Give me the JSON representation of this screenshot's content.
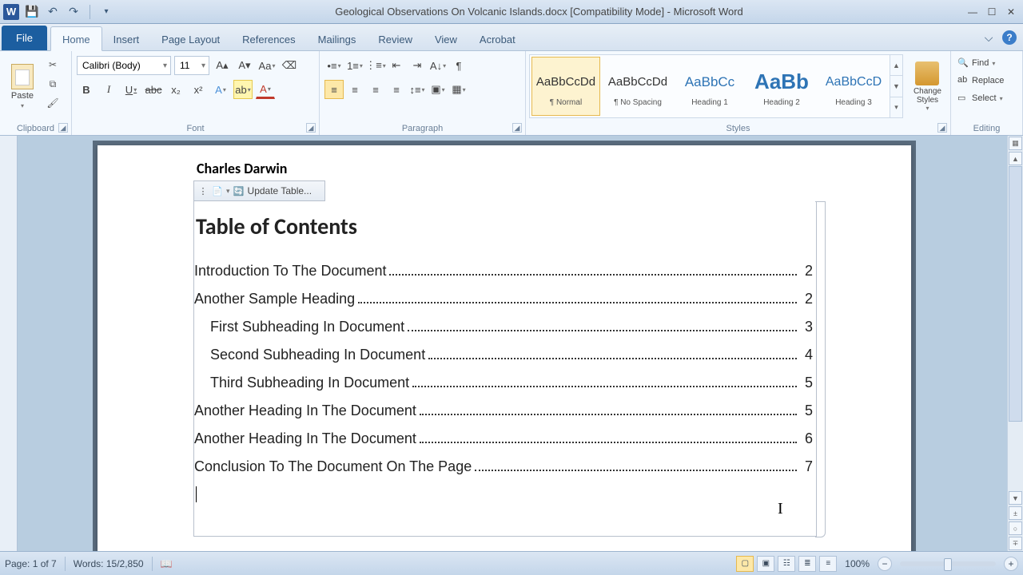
{
  "title": "Geological Observations On Volcanic Islands.docx [Compatibility Mode] - Microsoft Word",
  "tabs": {
    "file": "File",
    "home": "Home",
    "insert": "Insert",
    "page_layout": "Page Layout",
    "references": "References",
    "mailings": "Mailings",
    "review": "Review",
    "view": "View",
    "acrobat": "Acrobat"
  },
  "ribbon": {
    "clipboard": {
      "label": "Clipboard",
      "paste": "Paste"
    },
    "font": {
      "label": "Font",
      "name": "Calibri (Body)",
      "size": "11"
    },
    "paragraph": {
      "label": "Paragraph"
    },
    "styles": {
      "label": "Styles",
      "items": [
        {
          "preview": "AaBbCcDd",
          "name": "¶ Normal"
        },
        {
          "preview": "AaBbCcDd",
          "name": "¶ No Spacing"
        },
        {
          "preview": "AaBbCc",
          "name": "Heading 1"
        },
        {
          "preview": "AaBb",
          "name": "Heading 2"
        },
        {
          "preview": "AaBbCcD",
          "name": "Heading 3"
        }
      ],
      "change": "Change Styles"
    },
    "editing": {
      "label": "Editing",
      "find": "Find",
      "replace": "Replace",
      "select": "Select"
    }
  },
  "document": {
    "author": "Charles Darwin",
    "update_btn": "Update Table...",
    "toc_title": "Table of Contents",
    "toc": [
      {
        "text": "Introduction To The Document",
        "page": "2",
        "sub": false
      },
      {
        "text": "Another Sample Heading",
        "page": "2",
        "sub": false
      },
      {
        "text": "First Subheading In Document",
        "page": "3",
        "sub": true
      },
      {
        "text": "Second Subheading In Document",
        "page": "4",
        "sub": true
      },
      {
        "text": "Third Subheading In Document",
        "page": "5",
        "sub": true
      },
      {
        "text": "Another Heading In The Document",
        "page": "5",
        "sub": false
      },
      {
        "text": "Another Heading In The Document",
        "page": "6",
        "sub": false
      },
      {
        "text": "Conclusion To The Document On The Page",
        "page": "7",
        "sub": false
      }
    ]
  },
  "status": {
    "page": "Page: 1 of 7",
    "words": "Words: 15/2,850",
    "zoom": "100%"
  }
}
